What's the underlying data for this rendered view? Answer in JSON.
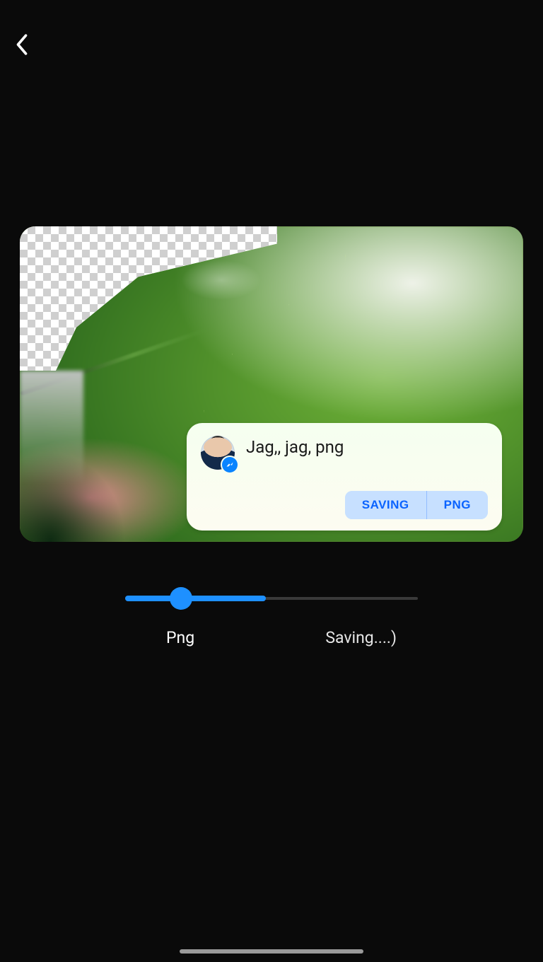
{
  "nav": {
    "back_aria": "Back"
  },
  "card": {
    "message": "Jag,, jag, png",
    "messenger_badge": "messenger",
    "buttons": {
      "saving": "SAVING",
      "png": "PNG"
    }
  },
  "slider": {
    "value_percent": 48,
    "active_width_percent": 48,
    "thumb_percent": 19,
    "labels": {
      "left": "Png",
      "right": "Saving....)"
    }
  },
  "colors": {
    "accent": "#1e90ff",
    "card_button_text": "#0a63ff",
    "card_button_bg": "#c7e0ff",
    "background": "#0a0a0a"
  }
}
